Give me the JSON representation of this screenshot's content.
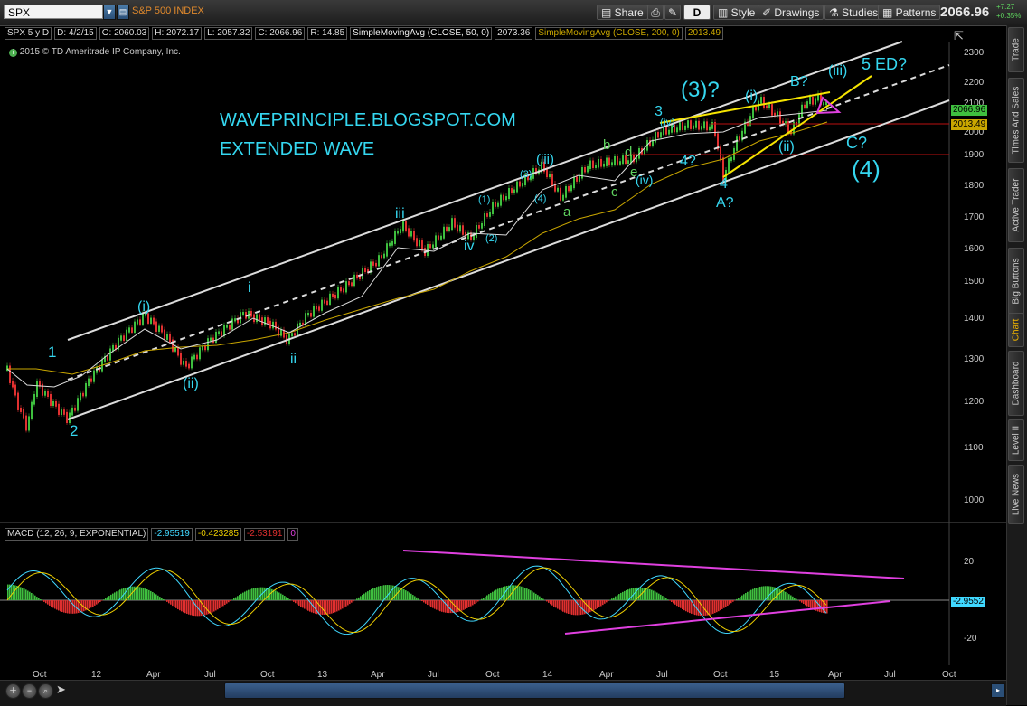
{
  "toolbar": {
    "symbol": "SPX",
    "index_name": "S&P 500 INDEX",
    "share_label": "Share",
    "aggregation": "D",
    "style_label": "Style",
    "drawings_label": "Drawings",
    "studies_label": "Studies",
    "patterns_label": "Patterns",
    "last_price": "2066.96",
    "change_pts": "+7.27",
    "change_pct": "+0.35%"
  },
  "infobar": {
    "symbol_period": "SPX 5 y D",
    "date": "D: 4/2/15",
    "open": "O: 2060.03",
    "high": "H: 2072.17",
    "low": "L: 2057.32",
    "close": "C: 2066.96",
    "range": "R: 14.85",
    "sma50_label": "SimpleMovingAvg (CLOSE, 50, 0)",
    "sma50_value": "2073.36",
    "sma200_label": "SimpleMovingAvg (CLOSE, 200, 0)",
    "sma200_value": "2013.49",
    "copyright": "2015 © TD Ameritrade IP Company, Inc."
  },
  "annotations": {
    "blog": "WAVEPRINCIPLE.BLOGSPOT.COM",
    "subtitle": "EXTENDED WAVE"
  },
  "price_axis": [
    "2300",
    "2200",
    "2100",
    "2000",
    "1900",
    "1800",
    "1700",
    "1600",
    "1500",
    "1400",
    "1300",
    "1200",
    "1100",
    "1000"
  ],
  "price_tags": {
    "last": "2066.96",
    "sma200": "2013.49"
  },
  "time_axis": [
    "Oct",
    "12",
    "Apr",
    "Jul",
    "Oct",
    "13",
    "Apr",
    "Jul",
    "Oct",
    "14",
    "Apr",
    "Jul",
    "Oct",
    "15",
    "Apr",
    "Jul",
    "Oct"
  ],
  "macd": {
    "label": "MACD (12, 26, 9, EXPONENTIAL)",
    "value": "-2.95519",
    "avg": "-0.423285",
    "diff": "-2.53191",
    "zero": "0",
    "axis": [
      "20",
      "-20"
    ],
    "tag": "-2.9552"
  },
  "side_tabs": [
    "Trade",
    "Times And Sales",
    "Active Trader",
    "Big Buttons",
    "Chart",
    "Dashboard",
    "Level II",
    "Live News"
  ],
  "wave_labels": {
    "w1": "1",
    "w2": "2",
    "wi": "(i)",
    "wii": "(ii)",
    "ri": "i",
    "rii": "ii",
    "riii": "iii",
    "riv": "iv",
    "p1": "(1)",
    "p2": "(2)",
    "p3": "(3)",
    "p4": "(4)",
    "piii": "(iii)",
    "w3": "3",
    "piv": "(iv)",
    "q4": "4?",
    "w4": "4",
    "aq": "A?",
    "iv2": "(iv)",
    "a": "a",
    "b": "b",
    "c": "c",
    "d": "d",
    "e": "e",
    "big3": "(3)?",
    "i2": "(i)",
    "ii2": "(ii)",
    "bq": "B?",
    "iii2": "(iii)",
    "ed": "5 ED?",
    "cq": "C?",
    "big4": "(4)"
  },
  "colors": {
    "up": "#3fbf3f",
    "down": "#e03030",
    "sma50": "#dcdcdc",
    "sma200": "#c9a600",
    "channel": "#dcdcdc",
    "yellow": "#f5e400",
    "magenta": "#e040e0",
    "cyan": "#35d7f0",
    "green": "#5fd35f"
  }
}
